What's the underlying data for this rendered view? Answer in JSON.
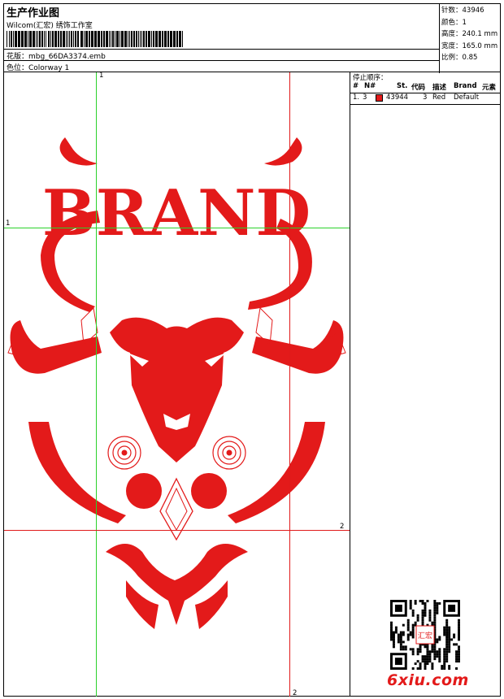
{
  "header": {
    "title": "生产作业图",
    "company": "Wilcom(汇宏) 绣饰工作室",
    "design_line": "花版：mbg_66DA3374.emb",
    "color_line": "色位：Colorway 1"
  },
  "info": {
    "stitches": "针数：43946",
    "colors": "颜色：1",
    "height": "高度：240.1 mm",
    "width": "宽度：165.0 mm",
    "scale": "比例：0.85"
  },
  "stop_sequence": {
    "title": "停止顺序：",
    "headers": [
      "#",
      "N#",
      "St.",
      "代码",
      "描述",
      "Brand",
      "元素"
    ],
    "rows": [
      {
        "index": "1.",
        "needle": "3",
        "stitches": "43944",
        "code": "3",
        "description": "Red",
        "brand": "Default",
        "swatch": "#e31a1a"
      }
    ]
  },
  "guides": {
    "green_v": "1",
    "green_h": "1",
    "red_v": "2",
    "red_h": "2"
  },
  "design": {
    "word": "BRAND",
    "thread_color": "#e31a1a"
  },
  "watermark": {
    "text": "6xiu.com",
    "stamp_text": "汇宏"
  },
  "colors": {
    "green_guide": "#2bd12b",
    "red_guide": "#e01a1a",
    "embroidery": "#e31a1a"
  }
}
